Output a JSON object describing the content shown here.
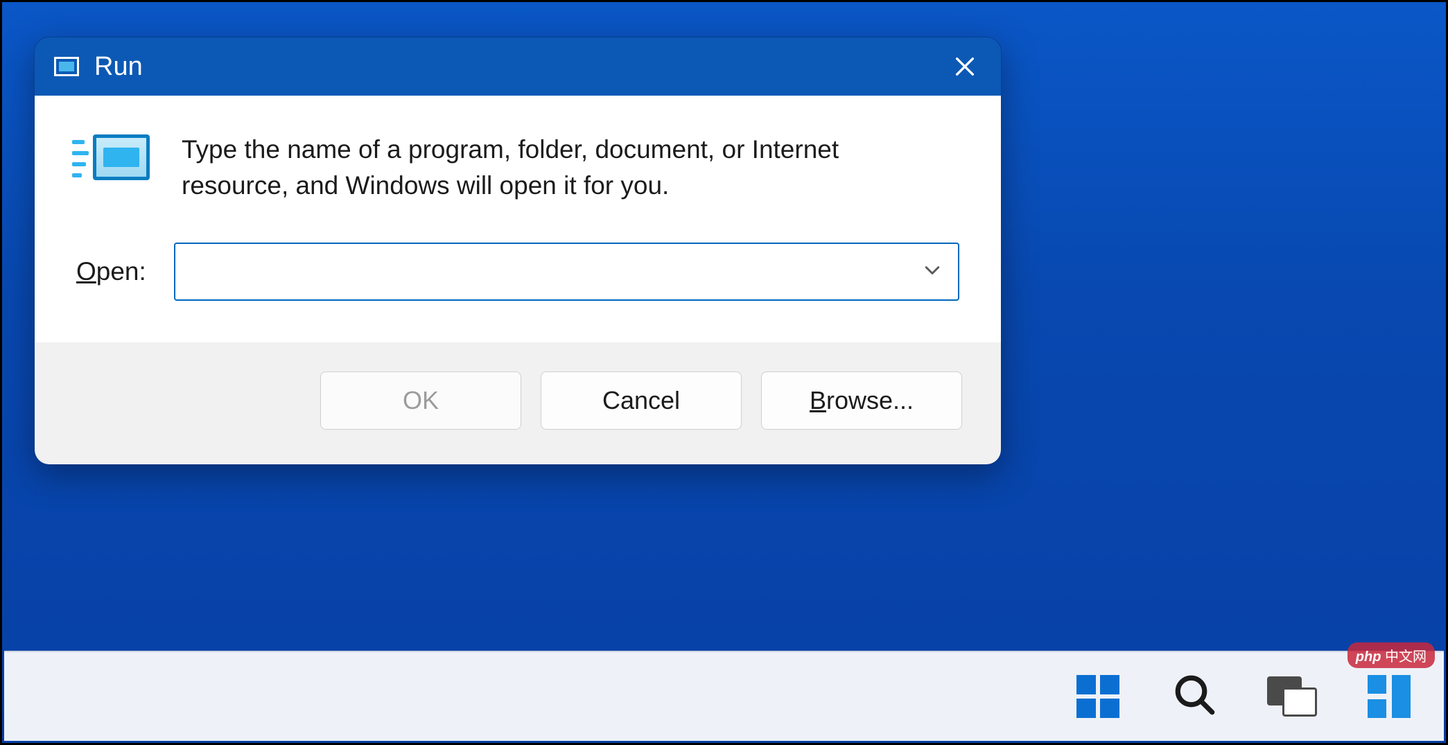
{
  "dialog": {
    "title": "Run",
    "description": "Type the name of a program, folder, document, or Internet resource, and Windows will open it for you.",
    "open_label_underlined_char": "O",
    "open_label_rest": "pen:",
    "open_value": "",
    "buttons": {
      "ok": "OK",
      "cancel": "Cancel",
      "browse_underlined_char": "B",
      "browse_rest": "rowse..."
    }
  },
  "watermark": "php 中文网"
}
